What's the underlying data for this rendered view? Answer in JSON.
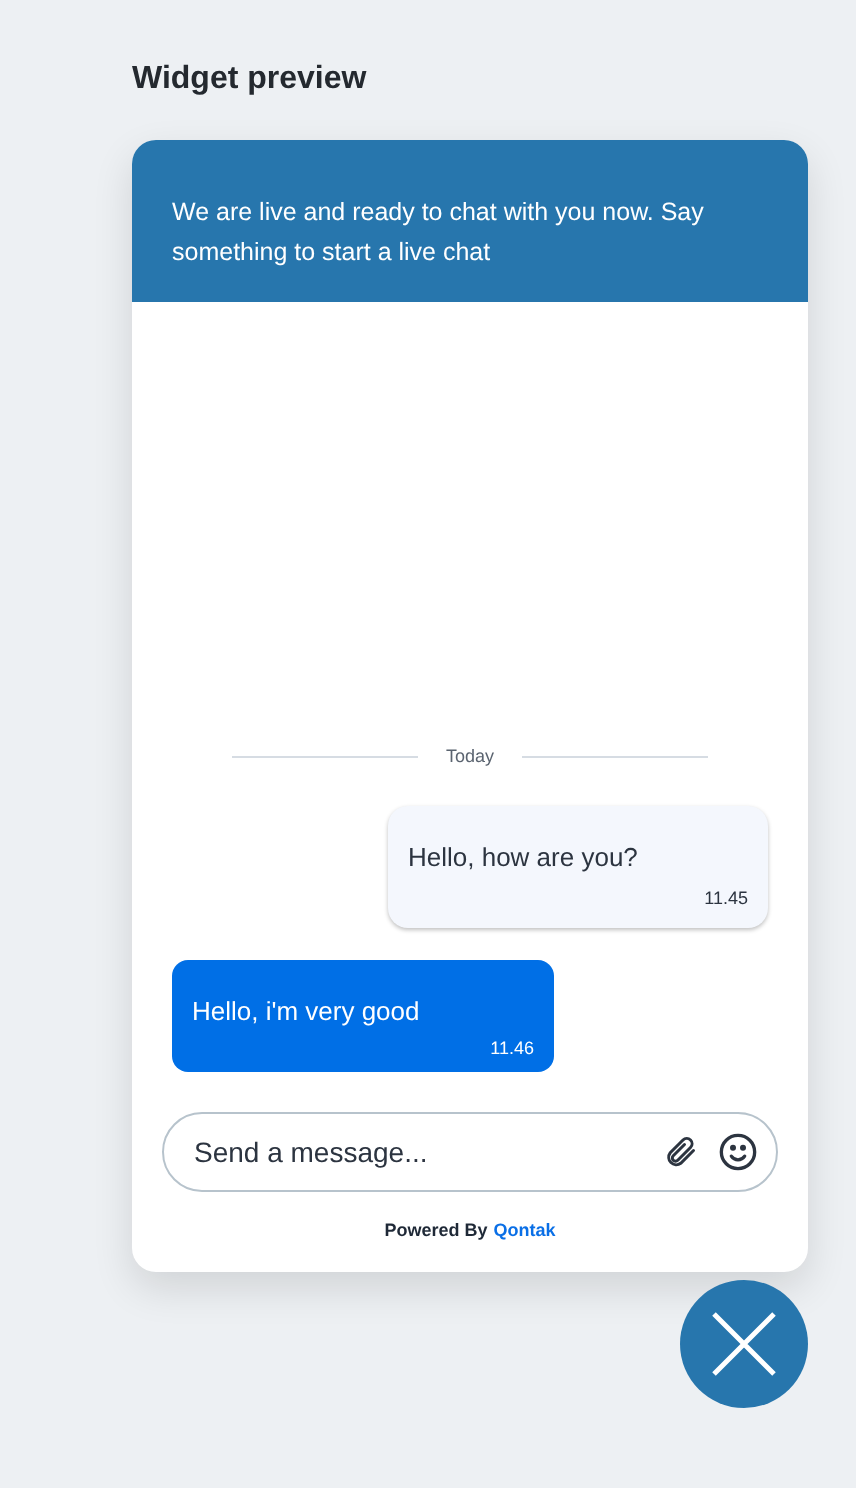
{
  "title": "Widget preview",
  "header": {
    "text": "We are live and ready to chat with you now. Say something to start a live chat"
  },
  "divider": {
    "label": "Today"
  },
  "messages": [
    {
      "kind": "outgoing",
      "text": "Hello, how are you?",
      "time": "11.45"
    },
    {
      "kind": "incoming",
      "text": "Hello, i'm very good",
      "time": "11.46"
    }
  ],
  "composer": {
    "placeholder": "Send a message..."
  },
  "footer": {
    "powered_by": "Powered By",
    "brand": "Qontak"
  }
}
